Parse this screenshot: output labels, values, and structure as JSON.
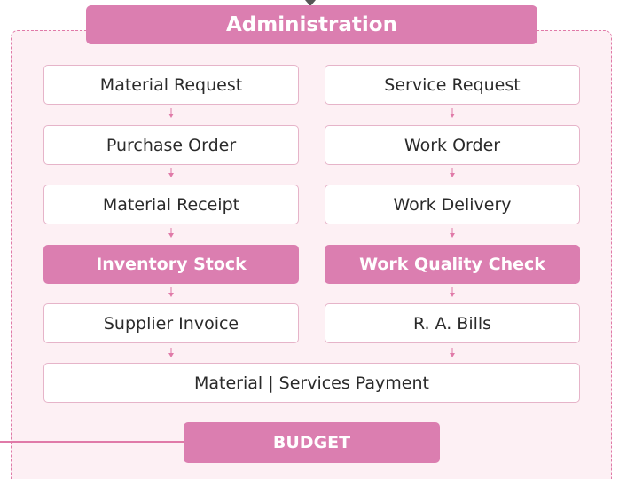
{
  "header": {
    "title": "Administration"
  },
  "material_flow": [
    "Material Request",
    "Purchase Order",
    "Material Receipt",
    "Inventory Stock",
    "Supplier Invoice"
  ],
  "service_flow": [
    "Service Request",
    "Work Order",
    "Work Delivery",
    "Work Quality Check",
    "R. A. Bills"
  ],
  "payment": {
    "label": "Material | Services Payment"
  },
  "budget": {
    "label": "BUDGET"
  },
  "colors": {
    "accent": "#db7eb0",
    "frame_background": "#fdf0f4",
    "frame_border": "#e07aa8",
    "box_border": "#e6b4c9"
  }
}
